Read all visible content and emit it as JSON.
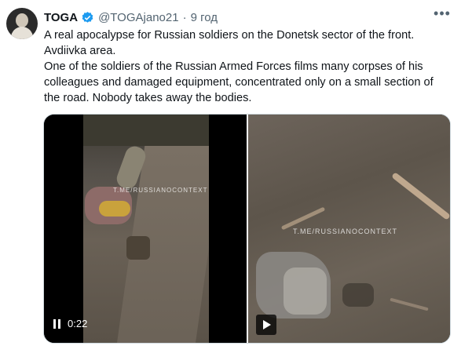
{
  "tweet": {
    "author_name": "TOGA",
    "handle": "@TOGAjano21",
    "separator": "·",
    "time": "9 год",
    "text_lines": [
      "A real apocalypse for Russian soldiers on the Donetsk sector of the front.",
      "Avdiivka area.",
      "One of the soldiers of the Russian Armed Forces films many corpses of his",
      "colleagues and damaged equipment, concentrated only on a small section of",
      "the road. Nobody takes away the bodies."
    ]
  },
  "media": {
    "left_video": {
      "watermark": "T.ME/RUSSIANOCONTEXT",
      "duration": "0:22",
      "control_icon": "pause-icon"
    },
    "right_video": {
      "watermark": "T.ME/RUSSIANOCONTEXT",
      "control_icon": "play-icon"
    }
  },
  "icons": {
    "verified": "verified-badge-icon",
    "more": "more-icon"
  },
  "colors": {
    "verified_blue": "#1d9bf0",
    "text": "#0f1419",
    "secondary": "#536471"
  }
}
